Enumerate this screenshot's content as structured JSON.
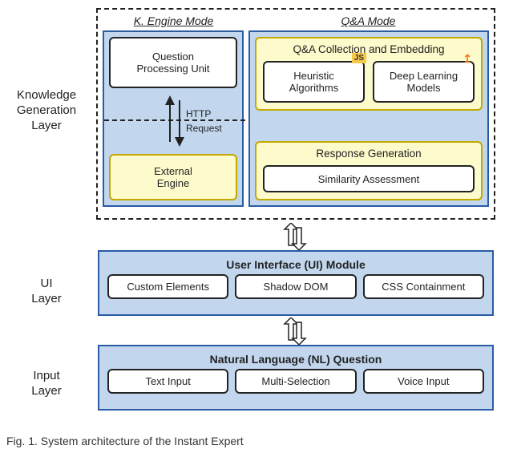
{
  "layers": {
    "knowledge": {
      "label": "Knowledge\nGeneration\nLayer"
    },
    "ui": {
      "label": "UI\nLayer"
    },
    "input": {
      "label": "Input\nLayer"
    }
  },
  "kg": {
    "k_mode_title": "K. Engine Mode",
    "qa_mode_title": "Q&A Mode",
    "qpu": "Question\nProcessing Unit",
    "http": "HTTP",
    "request": "Request",
    "external_engine": "External\nEngine",
    "qa_collection": "Q&A Collection and Embedding",
    "heuristic": "Heuristic\nAlgorithms",
    "deep_learning": "Deep Learning\nModels",
    "response_gen": "Response Generation",
    "similarity": "Similarity Assessment",
    "js_badge": "JS",
    "tf_badge": "↥"
  },
  "ui": {
    "title": "User Interface (UI) Module",
    "custom_elements": "Custom Elements",
    "shadow_dom": "Shadow DOM",
    "css_containment": "CSS Containment"
  },
  "input": {
    "title": "Natural Language (NL) Question",
    "text_input": "Text Input",
    "multi_selection": "Multi-Selection",
    "voice_input": "Voice Input"
  },
  "caption": "Fig. 1. System architecture of the Instant Expert"
}
